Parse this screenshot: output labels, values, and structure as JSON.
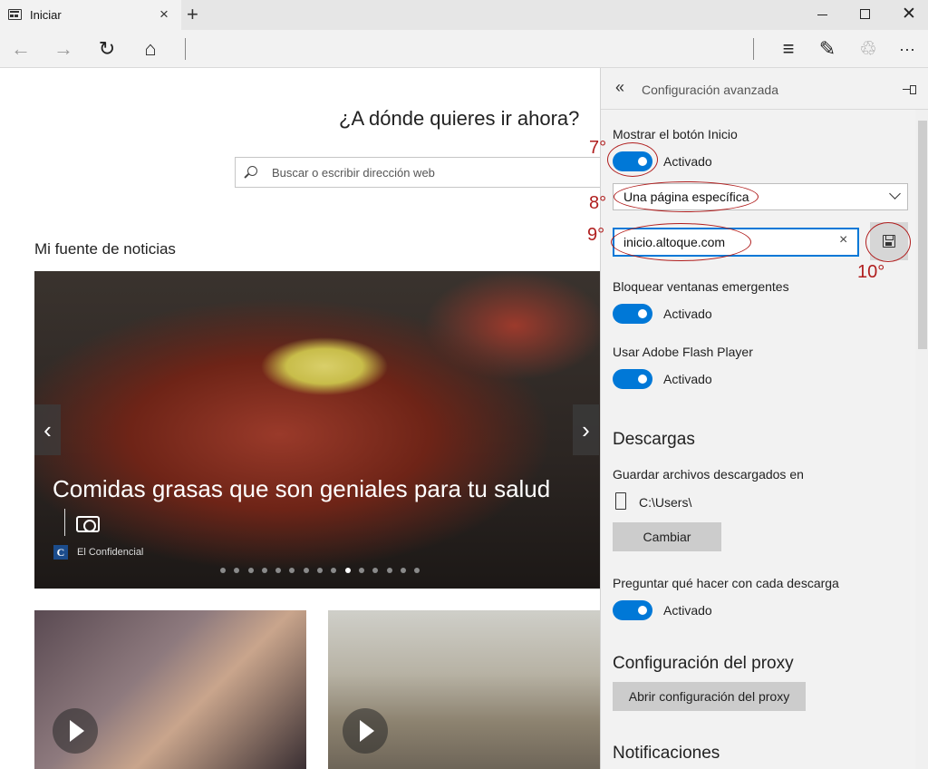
{
  "tab": {
    "title": "Iniciar"
  },
  "titlebar": {
    "close_glyph": "×",
    "newtab_glyph": "+",
    "window_close_glyph": "✕"
  },
  "navbar": {
    "back_glyph": "←",
    "forward_glyph": "→",
    "refresh_glyph": "↻",
    "home_glyph": "⌂",
    "hub_glyph": "≡",
    "note_glyph": "✎",
    "share_glyph": "♲",
    "more_glyph": "···"
  },
  "page": {
    "headline": "¿A dónde quieres ir ahora?",
    "search_placeholder": "Buscar o escribir dirección web",
    "feed_title": "Mi fuente de noticias",
    "hero": {
      "caption": "Comidas grasas que son geniales para tu salud",
      "source_logo": "C",
      "source": "El Confidencial",
      "prev_glyph": "‹",
      "next_glyph": "›",
      "dots_total": 15,
      "dots_active_index": 9
    }
  },
  "panel": {
    "back_glyph": "«",
    "title": "Configuración avanzada",
    "show_home": {
      "label": "Mostrar el botón Inicio",
      "state": "Activado"
    },
    "home_select": {
      "value": "Una página específica"
    },
    "home_url": {
      "value": "inicio.altoque.com",
      "clear_glyph": "×"
    },
    "popups": {
      "label": "Bloquear ventanas emergentes",
      "state": "Activado"
    },
    "flash": {
      "label": "Usar Adobe Flash Player",
      "state": "Activado"
    },
    "downloads": {
      "heading": "Descargas",
      "save_label": "Guardar archivos descargados en",
      "path": "C:\\Users\\",
      "change_button": "Cambiar",
      "ask_label": "Preguntar qué hacer con cada descarga",
      "ask_state": "Activado"
    },
    "proxy": {
      "heading": "Configuración del proxy",
      "button": "Abrir configuración del proxy"
    },
    "notifications": {
      "heading": "Notificaciones"
    }
  },
  "annotations": {
    "n7": "7°",
    "n8": "8°",
    "n9": "9°",
    "n10": "10°"
  },
  "colors": {
    "accent": "#0078d7",
    "annotation": "#b01e1e"
  }
}
